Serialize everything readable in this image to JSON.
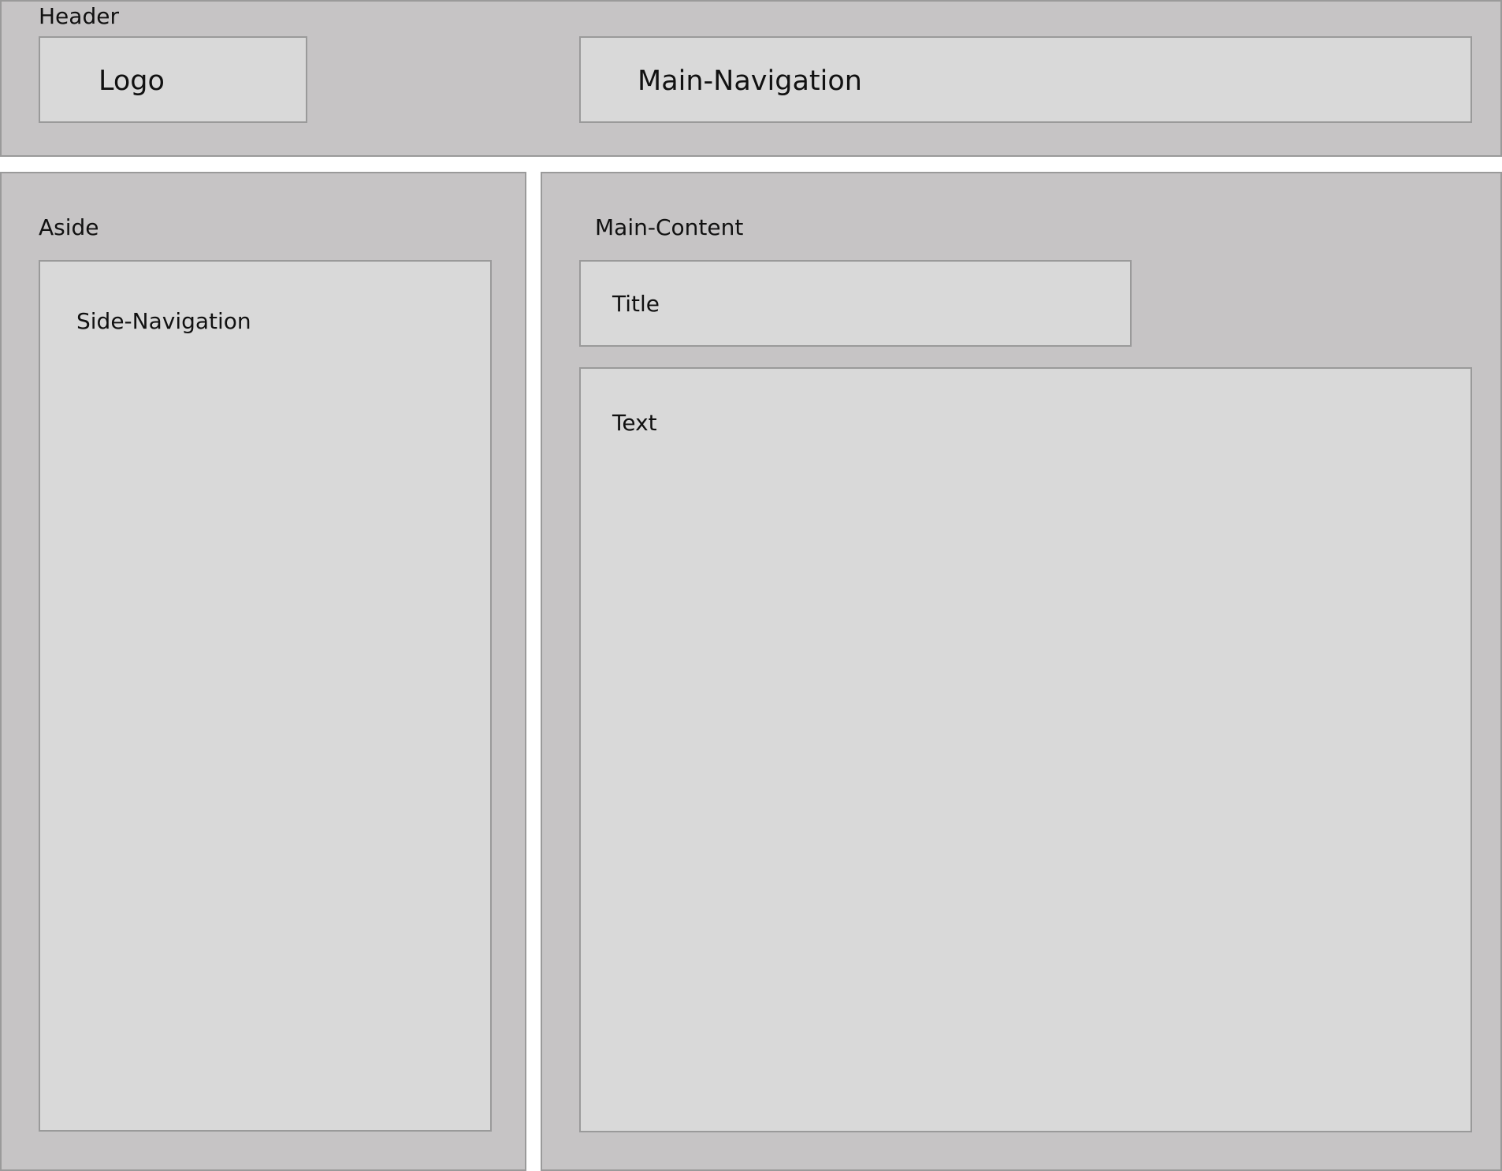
{
  "header": {
    "label": "Header",
    "logo": "Logo",
    "main_navigation": "Main-Navigation"
  },
  "aside": {
    "label": "Aside",
    "side_navigation": "Side-Navigation"
  },
  "main_content": {
    "label": "Main-Content",
    "title": "Title",
    "text": "Text"
  },
  "colors": {
    "region_fill": "#c6c4c5",
    "box_fill": "#d9d9d9",
    "border": "#9a9a9a"
  }
}
